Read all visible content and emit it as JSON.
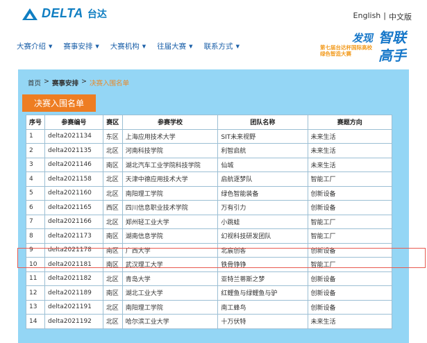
{
  "header": {
    "logo_text": "DELTA",
    "logo_cn": "台达",
    "lang_en": "English",
    "lang_sep": "|",
    "lang_cn": "中文版"
  },
  "nav": [
    {
      "label": "大赛介绍"
    },
    {
      "label": "赛事安排"
    },
    {
      "label": "大赛机构"
    },
    {
      "label": "往届大赛"
    },
    {
      "label": "联系方式"
    }
  ],
  "slogan": {
    "line1": "发现",
    "line2": "智联",
    "line3": "第七届台达杯国际高校绿色智造大赛",
    "line4": "高手"
  },
  "breadcrumb": {
    "home": "首页",
    "sep": ">",
    "section": "赛事安排",
    "current": "决赛入围名单"
  },
  "section_title": "决赛入围名单",
  "table": {
    "headers": [
      "序号",
      "参赛编号",
      "赛区",
      "参赛学校",
      "团队名称",
      "赛题方向"
    ],
    "rows": [
      [
        "1",
        "delta2021134",
        "东区",
        "上海应用技术大学",
        "SIT未来视野",
        "未来生活"
      ],
      [
        "2",
        "delta2021135",
        "北区",
        "河南科技学院",
        "利智启航",
        "未来生活"
      ],
      [
        "3",
        "delta2021146",
        "南区",
        "湖北汽车工业学院科技学院",
        "仙城",
        "未来生活"
      ],
      [
        "4",
        "delta2021158",
        "北区",
        "天津中德应用技术大学",
        "启航逐梦队",
        "智能工厂"
      ],
      [
        "5",
        "delta2021160",
        "北区",
        "南阳理工学院",
        "绿色智能装备",
        "创新设备"
      ],
      [
        "6",
        "delta2021165",
        "西区",
        "四川信息职业技术学院",
        "万有引力",
        "创新设备"
      ],
      [
        "7",
        "delta2021166",
        "北区",
        "郑州轻工业大学",
        "小跳蛙",
        "智能工厂"
      ],
      [
        "8",
        "delta2021173",
        "南区",
        "湖南信息学院",
        "幻视科技研发团队",
        "智能工厂"
      ],
      [
        "9",
        "delta2021178",
        "南区",
        "广西大学",
        "北宸创客",
        "创新设备"
      ],
      [
        "10",
        "delta2021181",
        "南区",
        "武汉理工大学",
        "铁骨铮铮",
        "智能工厂"
      ],
      [
        "11",
        "delta2021182",
        "北区",
        "青岛大学",
        "亚特兰蒂斯之梦",
        "创新设备"
      ],
      [
        "12",
        "delta2021189",
        "南区",
        "湖北工业大学",
        "红鲤鱼与绿鲤鱼与驴",
        "创新设备"
      ],
      [
        "13",
        "delta2021191",
        "北区",
        "南阳理工学院",
        "南工蜂鸟",
        "创新设备"
      ],
      [
        "14",
        "delta2021192",
        "北区",
        "哈尔滨工业大学",
        "十万伏特",
        "未来生活"
      ]
    ]
  },
  "colors": {
    "brand_blue": "#0f7ec2",
    "panel_bg": "#94d6f5",
    "accent_orange": "#ee7d22",
    "highlight_red": "#e85a4f"
  }
}
